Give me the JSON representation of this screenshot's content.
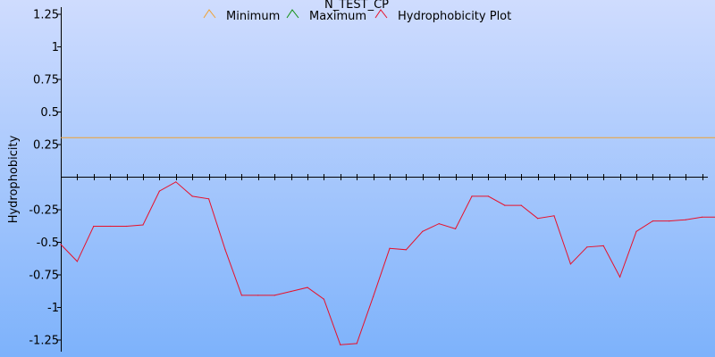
{
  "chart_data": {
    "type": "line",
    "title": "N_TEST_CP",
    "xlabel": "",
    "ylabel": "Hydrophobicity",
    "ylim": [
      -1.3,
      1.3
    ],
    "grid": false,
    "legend_placement": "top-center",
    "y_ticks": [
      {
        "value": 1.25,
        "label": "1.25"
      },
      {
        "value": 1.0,
        "label": "1"
      },
      {
        "value": 0.75,
        "label": "0.75"
      },
      {
        "value": 0.5,
        "label": "0.5"
      },
      {
        "value": 0.25,
        "label": "0.25"
      },
      {
        "value": -0.25,
        "label": "-0.25"
      },
      {
        "value": -0.5,
        "label": "-0.5"
      },
      {
        "value": -0.75,
        "label": "-0.75"
      },
      {
        "value": -1.0,
        "label": "-1"
      },
      {
        "value": -1.25,
        "label": "-1.25"
      }
    ],
    "x": [
      1,
      2,
      3,
      4,
      5,
      6,
      7,
      8,
      9,
      10,
      11,
      12,
      13,
      14,
      15,
      16,
      17,
      18,
      19,
      20,
      21,
      22,
      23,
      24,
      25,
      26,
      27,
      28,
      29,
      30,
      31,
      32,
      33,
      34,
      35,
      36,
      37,
      38,
      39,
      40,
      41,
      42
    ],
    "series": [
      {
        "name": "Minimum",
        "color": "#f0a030",
        "values": [
          0.3,
          0.3,
          0.3,
          0.3,
          0.3,
          0.3,
          0.3,
          0.3,
          0.3,
          0.3,
          0.3,
          0.3,
          0.3,
          0.3,
          0.3,
          0.3,
          0.3,
          0.3,
          0.3,
          0.3,
          0.3,
          0.3,
          0.3,
          0.3,
          0.3,
          0.3,
          0.3,
          0.3,
          0.3,
          0.3,
          0.3,
          0.3,
          0.3,
          0.3,
          0.3,
          0.3,
          0.3,
          0.3,
          0.3,
          0.3,
          0.3,
          0.3
        ]
      },
      {
        "name": "Maximum",
        "color": "#109010",
        "values": []
      },
      {
        "name": "Hydrophobicity Plot",
        "color": "#e8102a",
        "values": [
          -0.52,
          -0.65,
          -0.38,
          -0.38,
          -0.38,
          -0.37,
          -0.11,
          -0.04,
          -0.15,
          -0.17,
          -0.56,
          -0.91,
          -0.91,
          -0.91,
          -0.88,
          -0.85,
          -0.94,
          -1.29,
          -1.28,
          -0.92,
          -0.55,
          -0.56,
          -0.42,
          -0.36,
          -0.4,
          -0.15,
          -0.15,
          -0.22,
          -0.22,
          -0.32,
          -0.3,
          -0.67,
          -0.54,
          -0.53,
          -0.77,
          -0.42,
          -0.34,
          -0.34,
          -0.33,
          -0.31,
          -0.31,
          -0.31
        ]
      }
    ]
  }
}
